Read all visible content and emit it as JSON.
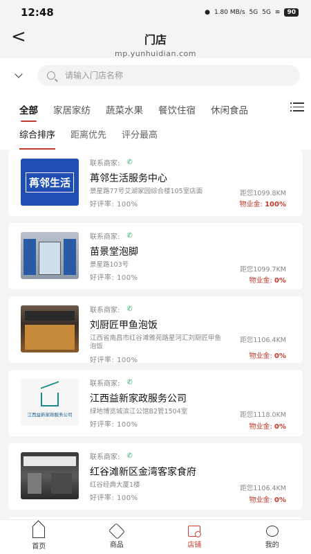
{
  "status_bar": {
    "time": "12:48",
    "net_speed": "1.80 MB/s",
    "signal1": "5G",
    "signal2": "5G",
    "battery": "90"
  },
  "header": {
    "title": "门店",
    "domain": "mp.yunhuidian.com"
  },
  "search": {
    "placeholder": "请输入门店名称"
  },
  "categories": [
    "全部",
    "家居家纺",
    "蔬菜水果",
    "餐饮住宿",
    "休闲食品"
  ],
  "sorts": [
    "综合排序",
    "距离优先",
    "评分最高"
  ],
  "stores": [
    {
      "contact_label": "联系商家:",
      "name": "苒邻生活服务中心",
      "address": "景星路77号艾湖家园综合楼105室店面",
      "rating_label": "好评率:",
      "rating": "100%",
      "distance": "距您1099.8KM",
      "fee_label": "物业金:",
      "fee": "100%",
      "logo_text": "苒邻生活"
    },
    {
      "contact_label": "联系商家:",
      "name": "苗景堂泡脚",
      "address": "景星路103号",
      "rating_label": "好评率:",
      "rating": "100%",
      "distance": "距您1099.7KM",
      "fee_label": "物业金:",
      "fee": "0%"
    },
    {
      "contact_label": "联系商家:",
      "name": "刘厨匠甲鱼泡饭",
      "address": "江西省南昌市红谷滩雅苑路星河汇刘厨匠甲鱼泡饭",
      "rating_label": "好评率:",
      "rating": "100%",
      "distance": "距您1106.4KM",
      "fee_label": "物业金:",
      "fee": "0%"
    },
    {
      "contact_label": "联系商家:",
      "name": "江西益新家政服务公司",
      "address": "绿地博览城滨江公馆B2管1504室",
      "rating_label": "好评率:",
      "rating": "100%",
      "distance": "距您1118.0KM",
      "fee_label": "物业金:",
      "fee": "0%",
      "logo_text": "江西益新家政服务公司"
    },
    {
      "contact_label": "联系商家:",
      "name": "红谷滩新区金湾客家食府",
      "address": "红谷经典大厦1楼",
      "rating_label": "好评率:",
      "rating": "100%",
      "distance": "距您1106.4KM",
      "fee_label": "物业金:",
      "fee": "0%"
    }
  ],
  "bottom_nav": [
    "首页",
    "商品",
    "店铺",
    "我的"
  ],
  "colors": {
    "accent": "#c0392b",
    "phone": "#27ae60"
  }
}
